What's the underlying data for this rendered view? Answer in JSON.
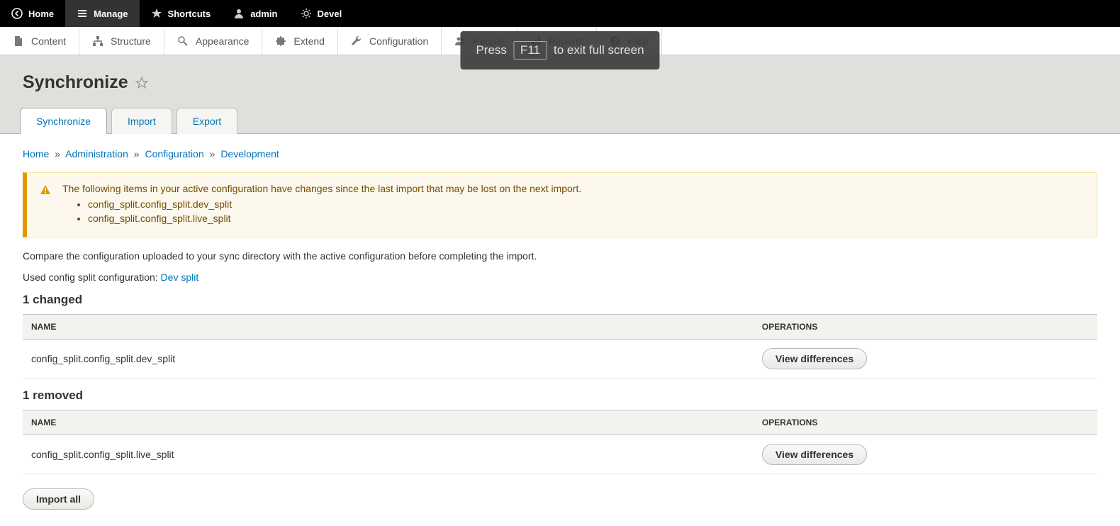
{
  "toolbar_top": {
    "home": "Home",
    "manage": "Manage",
    "shortcuts": "Shortcuts",
    "admin": "admin",
    "devel": "Devel"
  },
  "toolbar_admin": {
    "content": "Content",
    "structure": "Structure",
    "appearance": "Appearance",
    "extend": "Extend",
    "configuration": "Configuration",
    "people": "People",
    "reports": "Reports",
    "help": "Help"
  },
  "page_title": "Synchronize",
  "tabs": {
    "synchronize": "Synchronize",
    "import": "Import",
    "export": "Export"
  },
  "breadcrumb": {
    "home": "Home",
    "administration": "Administration",
    "configuration": "Configuration",
    "development": "Development"
  },
  "warning": {
    "text": "The following items in your active configuration have changes since the last import that may be lost on the next import.",
    "items": [
      "config_split.config_split.dev_split",
      "config_split.config_split.live_split"
    ]
  },
  "desc1": "Compare the configuration uploaded to your sync directory with the active configuration before completing the import.",
  "desc2_prefix": "Used config split configuration: ",
  "desc2_link": "Dev split",
  "changed": {
    "heading": "1 changed",
    "cols": {
      "name": "NAME",
      "operations": "OPERATIONS"
    },
    "rows": [
      {
        "name": "config_split.config_split.dev_split",
        "op": "View differences"
      }
    ]
  },
  "removed": {
    "heading": "1 removed",
    "cols": {
      "name": "NAME",
      "operations": "OPERATIONS"
    },
    "rows": [
      {
        "name": "config_split.config_split.live_split",
        "op": "View differences"
      }
    ]
  },
  "import_all": "Import all",
  "fullscreen": {
    "press": "Press",
    "key": "F11",
    "rest": "to exit full screen"
  }
}
